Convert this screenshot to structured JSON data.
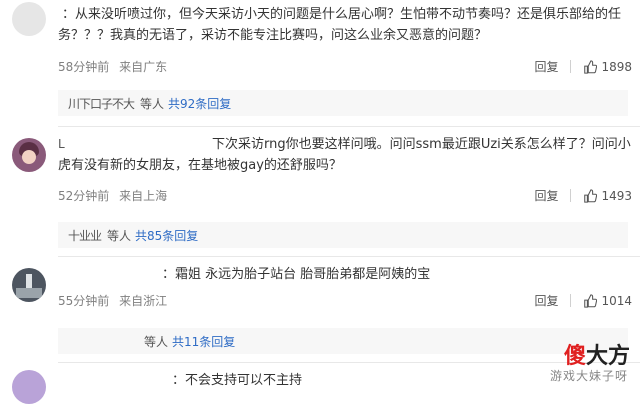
{
  "comments": [
    {
      "name": "",
      "text": "：从来没听喷过你，但今天采访小天的问题是什么居心啊？生怕带不动节奏吗？还是俱乐部给的任务？？？我真的无语了，采访不能专注比赛吗，问这么业余又恶意的问题？",
      "time": "58分钟前",
      "location": "来自广东",
      "reply_label": "回复",
      "likes": "1898",
      "replies": {
        "name": "川下口子不大",
        "suffix": "等人",
        "link": "共92条回复"
      }
    },
    {
      "name": "L",
      "text": "下次采访rng你也要这样问哦。问问ssm最近跟Uzi关系怎么样了？问问小虎有没有新的女朋友，在基地被gay的还舒服吗？",
      "time": "52分钟前",
      "location": "来自上海",
      "reply_label": "回复",
      "likes": "1493",
      "replies": {
        "name": "十业业",
        "suffix": "等人",
        "link": "共85条回复"
      }
    },
    {
      "name": "",
      "text": "：霜姐 永远为胎子站台 胎哥胎弟都是阿姨的宝",
      "time": "55分钟前",
      "location": "来自浙江",
      "reply_label": "回复",
      "likes": "1014",
      "replies": {
        "name": "",
        "suffix": "等人",
        "link": "共11条回复"
      }
    },
    {
      "name": "",
      "text": "：不会支持可以不主持",
      "time": "",
      "location": "",
      "reply_label": "",
      "likes": "",
      "replies": null
    }
  ],
  "watermark": {
    "part1": "傻",
    "part2": "大方",
    "subtitle": "游戏大妹子呀"
  },
  "colors": {
    "link": "#2f6cc5",
    "meta": "#808080",
    "reply_bg": "#f7f7f7"
  },
  "icons": {
    "like": "thumbs-up-icon"
  }
}
